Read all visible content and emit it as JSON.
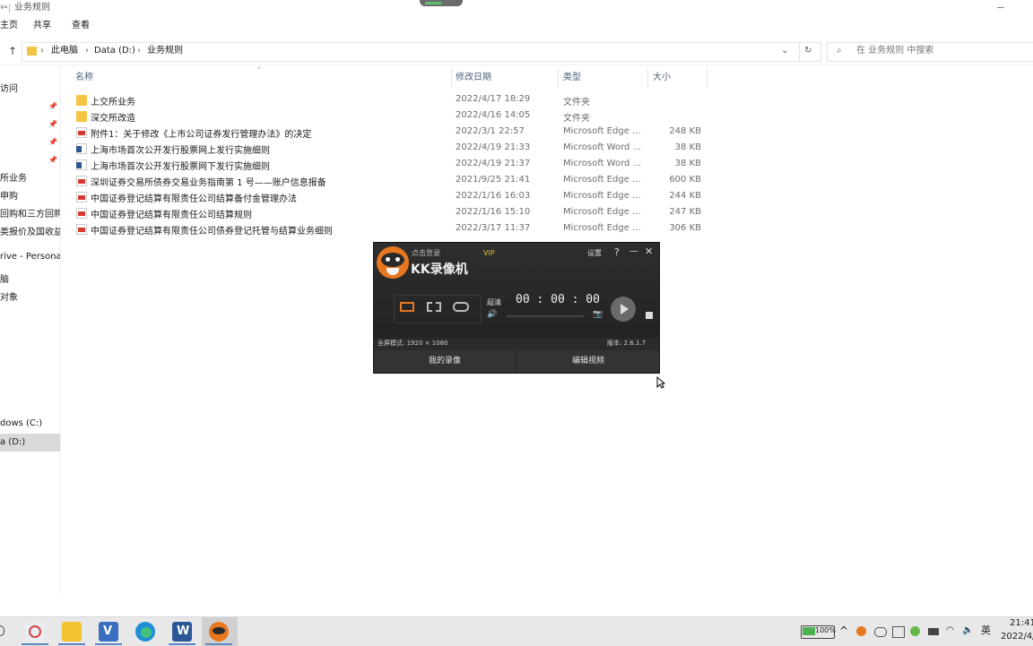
{
  "window": {
    "title": "业务规则",
    "back_glyph": "⇦"
  },
  "ribbon": {
    "tabs": [
      "主页",
      "共享",
      "查看"
    ]
  },
  "address": {
    "up_glyph": "↑",
    "breadcrumb": [
      "此电脑",
      "Data (D:)",
      "业务规则"
    ],
    "search_placeholder": "在 业务规则 中搜索"
  },
  "nav": {
    "items": [
      {
        "label": "访问"
      },
      {
        "label": "所业务"
      },
      {
        "label": "申购"
      },
      {
        "label": "回购和三方回购"
      },
      {
        "label": "类报价及国收益"
      },
      {
        "label": "rive - Persona"
      },
      {
        "label": "脑"
      },
      {
        "label": "对象"
      },
      {
        "label": "dows (C:)"
      },
      {
        "label": "a (D:)"
      }
    ]
  },
  "columns": {
    "name": "名称",
    "date": "修改日期",
    "type": "类型",
    "size": "大小"
  },
  "files": [
    {
      "icon": "folder-icon",
      "name": "上交所业务",
      "date": "2022/4/17 18:29",
      "type": "文件夹",
      "size": ""
    },
    {
      "icon": "folder-icon",
      "name": "深交所改造",
      "date": "2022/4/16 14:05",
      "type": "文件夹",
      "size": ""
    },
    {
      "icon": "pdf-icon",
      "name": "附件1：关于修改《上市公司证券发行管理办法》的决定",
      "date": "2022/3/1 22:57",
      "type": "Microsoft Edge ...",
      "size": "248 KB"
    },
    {
      "icon": "word-icon",
      "name": "上海市场首次公开发行股票网上发行实施细则",
      "date": "2022/4/19 21:33",
      "type": "Microsoft Word ...",
      "size": "38 KB"
    },
    {
      "icon": "word-icon",
      "name": "上海市场首次公开发行股票网下发行实施细则",
      "date": "2022/4/19 21:37",
      "type": "Microsoft Word ...",
      "size": "38 KB"
    },
    {
      "icon": "pdf-icon",
      "name": "深圳证券交易所债券交易业务指南第 1 号——账户信息报备",
      "date": "2021/9/25 21:41",
      "type": "Microsoft Edge ...",
      "size": "600 KB"
    },
    {
      "icon": "pdf-icon",
      "name": "中国证券登记结算有限责任公司结算备付金管理办法",
      "date": "2022/1/16 16:03",
      "type": "Microsoft Edge ...",
      "size": "244 KB"
    },
    {
      "icon": "pdf-icon",
      "name": "中国证券登记结算有限责任公司结算规则",
      "date": "2022/1/16 15:10",
      "type": "Microsoft Edge ...",
      "size": "247 KB"
    },
    {
      "icon": "pdf-icon",
      "name": "中国证券登记结算有限责任公司债券登记托管与结算业务细则",
      "date": "2022/3/17 11:37",
      "type": "Microsoft Edge ...",
      "size": "306 KB"
    }
  ],
  "recorder": {
    "login": "点击登录",
    "vip": "VIP",
    "settings": "设置",
    "help": "?",
    "minimize": "—",
    "close": "✕",
    "app_name": "KK录像机",
    "quality": "超清",
    "timer": "00 : 00 : 00",
    "mode_info": "全屏模式: 1920 × 1080",
    "version": "版本: 2.6.1.7",
    "my_recordings": "我的录像",
    "edit_video": "编辑视频",
    "volume_glyph": "🔊",
    "camera_glyph": "📷"
  },
  "taskbar": {
    "battery": "100%",
    "ime": "英",
    "time": "21:41",
    "date": "2022/4/"
  }
}
